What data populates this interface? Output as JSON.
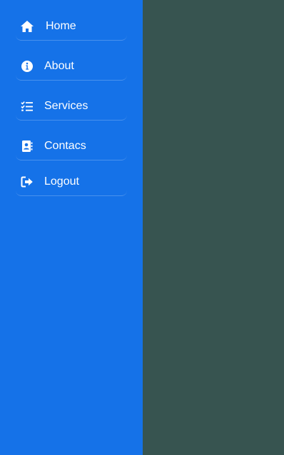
{
  "sidebar": {
    "background": "#1572e8",
    "items": [
      {
        "label": "Home",
        "icon": "home-icon"
      },
      {
        "label": "About",
        "icon": "info-icon"
      },
      {
        "label": "Services",
        "icon": "checklist-icon"
      },
      {
        "label": "Contacs",
        "icon": "contact-book-icon"
      },
      {
        "label": "Logout",
        "icon": "logout-icon"
      }
    ]
  },
  "content": {
    "background": "#375450"
  }
}
